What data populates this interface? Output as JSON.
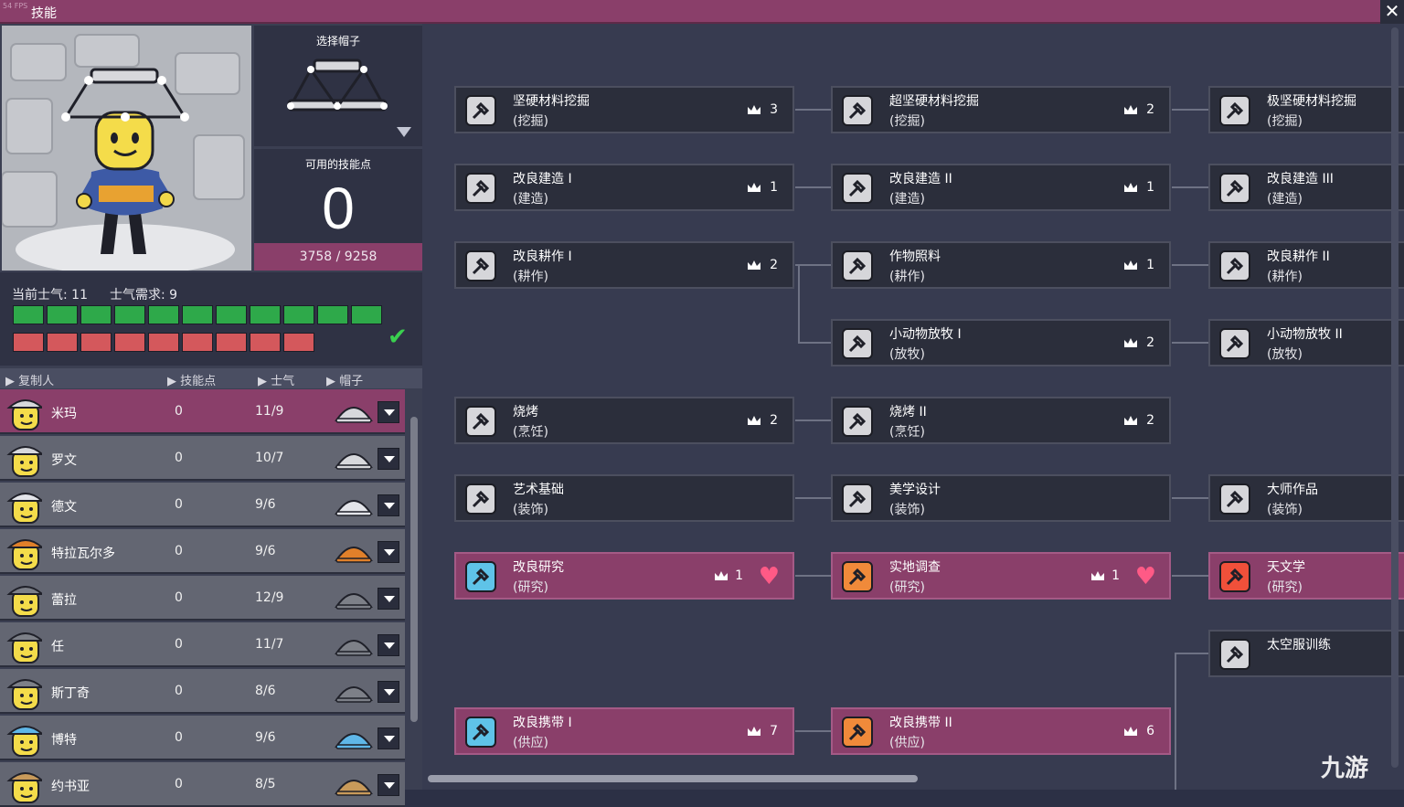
{
  "window": {
    "tiny_label": "54 FPS",
    "title": "技能",
    "close_label": "✕"
  },
  "hat_select": {
    "label": "选择帽子"
  },
  "skill_points": {
    "label": "可用的技能点",
    "value": "0",
    "xp": "3758 / 9258"
  },
  "morale": {
    "current_label": "当前士气: 11",
    "required_label": "士气需求: 9",
    "current": 11,
    "required": 9
  },
  "list_header": {
    "dupe": "复制人",
    "points": "技能点",
    "morale": "士气",
    "hat": "帽子"
  },
  "dupes": [
    {
      "name": "米玛",
      "points": "0",
      "morale": "11/9",
      "hat": "hat-icon"
    },
    {
      "name": "罗文",
      "points": "0",
      "morale": "10/7",
      "hat": "mining-hat-icon"
    },
    {
      "name": "德文",
      "points": "0",
      "morale": "9/6",
      "hat": "chef-hat-icon"
    },
    {
      "name": "特拉瓦尔多",
      "points": "0",
      "morale": "9/6",
      "hat": "orange-hardhat-icon"
    },
    {
      "name": "蕾拉",
      "points": "0",
      "morale": "12/9",
      "hat": "cap-icon"
    },
    {
      "name": "任",
      "points": "0",
      "morale": "11/7",
      "hat": "cap-icon"
    },
    {
      "name": "斯丁奇",
      "points": "0",
      "morale": "8/6",
      "hat": "cap-icon"
    },
    {
      "name": "博特",
      "points": "0",
      "morale": "9/6",
      "hat": "blue-cap-icon"
    },
    {
      "name": "约书亚",
      "points": "0",
      "morale": "8/5",
      "hat": "straw-hat-icon"
    }
  ],
  "skills": [
    {
      "name": "坚硬材料挖掘",
      "cat": "(挖掘)",
      "count": "3",
      "research": false
    },
    {
      "name": "超坚硬材料挖掘",
      "cat": "(挖掘)",
      "count": "2",
      "research": false
    },
    {
      "name": "极坚硬材料挖掘",
      "cat": "(挖掘)",
      "count": "",
      "research": false
    },
    {
      "name": "改良建造 I",
      "cat": "(建造)",
      "count": "1",
      "research": false
    },
    {
      "name": "改良建造 II",
      "cat": "(建造)",
      "count": "1",
      "research": false
    },
    {
      "name": "改良建造 III",
      "cat": "(建造)",
      "count": "",
      "research": false
    },
    {
      "name": "改良耕作 I",
      "cat": "(耕作)",
      "count": "2",
      "research": false
    },
    {
      "name": "作物照料",
      "cat": "(耕作)",
      "count": "1",
      "research": false
    },
    {
      "name": "改良耕作 II",
      "cat": "(耕作)",
      "count": "",
      "research": false
    },
    {
      "name": "小动物放牧 I",
      "cat": "(放牧)",
      "count": "2",
      "research": false
    },
    {
      "name": "小动物放牧 II",
      "cat": "(放牧)",
      "count": "",
      "research": false
    },
    {
      "name": "烧烤",
      "cat": "(烹饪)",
      "count": "2",
      "research": false
    },
    {
      "name": "烧烤 II",
      "cat": "(烹饪)",
      "count": "2",
      "research": false
    },
    {
      "name": "艺术基础",
      "cat": "(装饰)",
      "count": "",
      "research": false
    },
    {
      "name": "美学设计",
      "cat": "(装饰)",
      "count": "",
      "research": false
    },
    {
      "name": "大师作品",
      "cat": "(装饰)",
      "count": "",
      "research": false
    },
    {
      "name": "改良研究",
      "cat": "(研究)",
      "count": "1",
      "research": true
    },
    {
      "name": "实地调查",
      "cat": "(研究)",
      "count": "1",
      "research": true
    },
    {
      "name": "天文学",
      "cat": "(研究)",
      "count": "",
      "research": true
    },
    {
      "name": "太空服训练",
      "cat": "",
      "count": "",
      "research": false
    },
    {
      "name": "改良携带 I",
      "cat": "(供应)",
      "count": "7",
      "research": true
    },
    {
      "name": "改良携带 II",
      "cat": "(供应)",
      "count": "6",
      "research": true
    }
  ],
  "watermark": "九游",
  "colors": {
    "accent": "#8a3f6a",
    "morale_met": "#2ea94a",
    "morale_required": "#d4585c",
    "check": "#3ad04f",
    "heart": "#ff5a86"
  }
}
